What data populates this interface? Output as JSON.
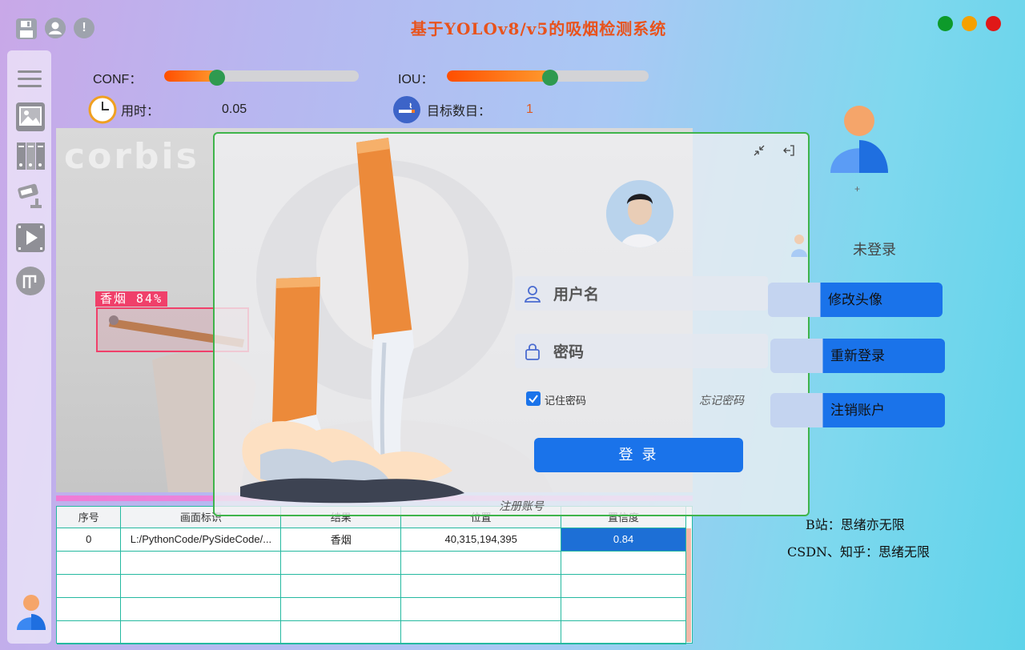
{
  "app": {
    "title": "基于YOLOv8/v5的吸烟检测系统",
    "colors": {
      "title": "#e8531c",
      "accent": "#1a73ea",
      "close": "#e01818",
      "minimize": "#f5a000",
      "maximize": "#0d9a2a"
    }
  },
  "toolbar": {
    "icons": [
      "save-icon",
      "user-icon",
      "info-icon"
    ],
    "info_glyph": "!"
  },
  "sidebar": {
    "items": [
      "menu-icon",
      "image-icon",
      "folder-icon",
      "camera-icon",
      "video-icon",
      "model-icon",
      "avatar-icon"
    ]
  },
  "controls": {
    "conf_label": "CONF：",
    "conf_value": 0.27,
    "iou_label": "IOU：",
    "iou_value": 0.51,
    "time_label": "用时：",
    "time_value": "0.05",
    "count_label": "目标数目：",
    "count_value": "1"
  },
  "detection": {
    "watermark": "corbis",
    "label": "香烟 84%"
  },
  "table": {
    "headers": [
      "序号",
      "画面标识",
      "结果",
      "位置",
      "置信度"
    ],
    "rows": [
      [
        "0",
        "L:/PythonCode/PySideCode/...",
        "香烟",
        "40,315,194,395",
        "0.84"
      ]
    ]
  },
  "login": {
    "username_placeholder": "用户名",
    "password_placeholder": "密码",
    "remember_label": "记住密码",
    "forgot_label": "忘记密码",
    "login_button": "登 录",
    "register_link": "注册账号"
  },
  "profile": {
    "avatar_plus": "+",
    "status": "未登录",
    "buttons": {
      "change_avatar": "修改头像",
      "relogin": "重新登录",
      "logout": "注销账户"
    },
    "credits": [
      "B站：思绪亦无限",
      "CSDN、知乎：思绪无限"
    ]
  }
}
